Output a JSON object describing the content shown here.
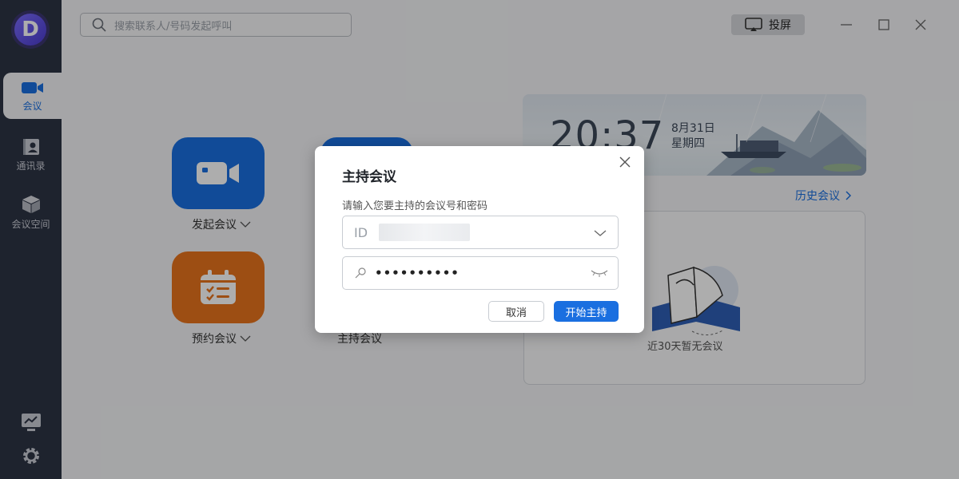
{
  "app": {
    "logo_letter": "D"
  },
  "sidebar": {
    "items": [
      {
        "label": "会议",
        "icon": "video-camera-icon",
        "active": true
      },
      {
        "label": "通讯录",
        "icon": "contacts-icon"
      },
      {
        "label": "会议空间",
        "icon": "cube-icon"
      }
    ],
    "bottom": [
      {
        "icon": "monitor-chart-icon"
      },
      {
        "icon": "gear-icon"
      }
    ]
  },
  "search": {
    "placeholder": "搜索联系人/号码发起呼叫"
  },
  "toolbar": {
    "cast_label": "投屏"
  },
  "actions": [
    {
      "label": "发起会议",
      "icon": "video-camera-icon",
      "color": "#1a6fe0",
      "has_dropdown": true
    },
    {
      "label": "预约会议",
      "icon": "calendar-icon",
      "color": "#e8741c",
      "has_dropdown": true
    },
    {
      "label": "主持会议",
      "icon": "host-icon",
      "color": "#1a6fe0",
      "has_dropdown": false
    }
  ],
  "banner": {
    "time": "20:37",
    "date": "8月31日",
    "weekday": "星期四"
  },
  "history": {
    "link_label": "历史会议",
    "empty_text": "近30天暂无会议"
  },
  "dialog": {
    "title": "主持会议",
    "prompt": "请输入您要主持的会议号和密码",
    "id_label": "ID",
    "password_mask": "••••••••••",
    "cancel_label": "取消",
    "confirm_label": "开始主持"
  },
  "colors": {
    "accent": "#1a6fe0",
    "sidebar": "#2d3445",
    "orange": "#e8741c"
  }
}
